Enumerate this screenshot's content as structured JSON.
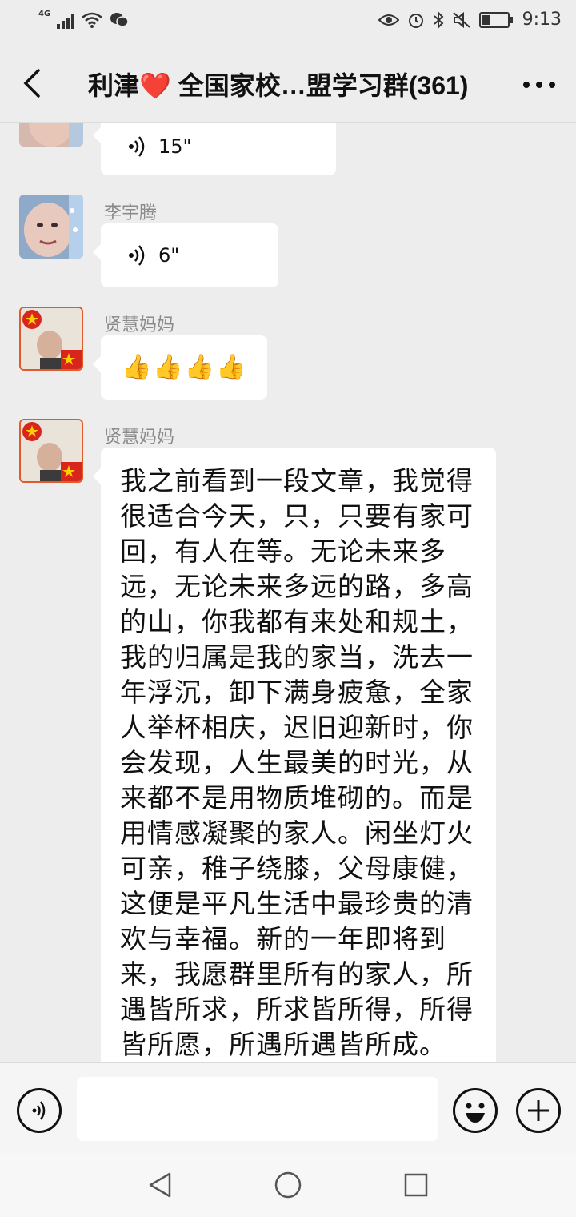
{
  "status_bar": {
    "network": "4G",
    "time": "9:13"
  },
  "header": {
    "title": "利津❤️ 全国家校…盟学习群(361)",
    "back_icon": "chevron-left-icon",
    "more_icon": "more-icon"
  },
  "messages": [
    {
      "sender": "",
      "type": "voice",
      "duration": "15\""
    },
    {
      "sender": "李宇腾",
      "type": "voice",
      "duration": "6\""
    },
    {
      "sender": "贤慧妈妈",
      "type": "emoji",
      "emoji": "👍👍👍👍"
    },
    {
      "sender": "贤慧妈妈",
      "type": "text",
      "text": "我之前看到一段文章，我觉得很适合今天，只，只要有家可回，有人在等。无论未来多远，无论未来多远的路，多高的山，你我都有来处和规土，我的归属是我的家当，洗去一年浮沉，卸下满身疲惫，全家人举杯相庆，迟旧迎新时，你会发现，人生最美的时光，从来都不是用物质堆砌的。而是用情感凝聚的家人。闲坐灯火可亲，稚子绕膝，父母康健，这便是平凡生活中最珍贵的清欢与幸福。新的一年即将到来，我愿群里所有的家人，所遇皆所求，所求皆所得，所得皆所愿，所遇所遇皆所成。"
    }
  ],
  "input_bar": {
    "voice_icon": "voice-icon",
    "emoji_icon": "emoji-icon",
    "add_icon": "plus-icon",
    "text_value": ""
  },
  "nav_bar": {
    "back_icon": "triangle-back-icon",
    "home_icon": "circle-home-icon",
    "recents_icon": "square-recents-icon"
  }
}
